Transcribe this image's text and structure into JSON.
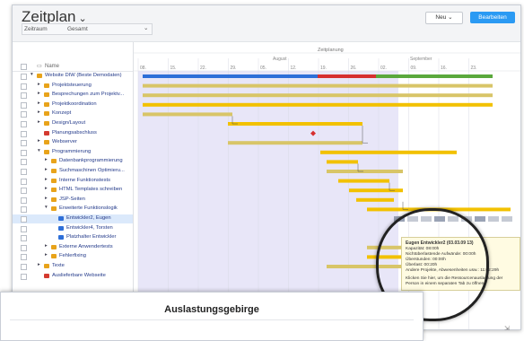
{
  "header": {
    "title": "Zeitplan",
    "title_caret": "⌄",
    "new_label": "Neu ⌄",
    "edit_label": "Bearbeiten"
  },
  "filters": {
    "range_label": "Zeitraum",
    "range_value": "Gesamt",
    "caret": "⌄"
  },
  "tree": {
    "col_name": "Name",
    "items": [
      {
        "label": "Website DIW (Beste Demodaten)",
        "level": 0,
        "icon": "project"
      },
      {
        "label": "Projektsteuerung",
        "level": 1,
        "icon": "folder"
      },
      {
        "label": "Besprechungen zum Projektv...",
        "level": 1,
        "icon": "folder"
      },
      {
        "label": "Projektkoordination",
        "level": 1,
        "icon": "folder"
      },
      {
        "label": "Konzept",
        "level": 1,
        "icon": "folder"
      },
      {
        "label": "Design/Layout",
        "level": 1,
        "icon": "folder"
      },
      {
        "label": "Planungsabschluss",
        "level": 1,
        "icon": "milestone"
      },
      {
        "label": "Webserver",
        "level": 1,
        "icon": "folder"
      },
      {
        "label": "Programmierung",
        "level": 1,
        "icon": "folder"
      },
      {
        "label": "Datenbankprogrammierung",
        "level": 2,
        "icon": "folder"
      },
      {
        "label": "Suchmaschinen Optimieru...",
        "level": 2,
        "icon": "folder"
      },
      {
        "label": "Interne Funktionstests",
        "level": 2,
        "icon": "folder"
      },
      {
        "label": "HTML Templates schreiben",
        "level": 2,
        "icon": "folder"
      },
      {
        "label": "JSP-Seiten",
        "level": 2,
        "icon": "folder"
      },
      {
        "label": "Erweiterte Funktionslogik",
        "level": 2,
        "icon": "folder"
      },
      {
        "label": "Entwickler2, Eugen",
        "level": 3,
        "icon": "person"
      },
      {
        "label": "Entwickler4, Torsten",
        "level": 3,
        "icon": "person"
      },
      {
        "label": "Platzhalter Entwickler",
        "level": 3,
        "icon": "person"
      },
      {
        "label": "Externe Anwendertests",
        "level": 2,
        "icon": "folder"
      },
      {
        "label": "Fehlerfixing",
        "level": 2,
        "icon": "folder"
      },
      {
        "label": "Texte",
        "level": 1,
        "icon": "folder"
      },
      {
        "label": "Auslieferbare Webseite",
        "level": 1,
        "icon": "milestone"
      }
    ]
  },
  "timeline": {
    "group_label": "Zeitplanung",
    "months": [
      "August",
      "September"
    ],
    "weeks": [
      "08.",
      "15.",
      "22.",
      "29.",
      "05.",
      "12.",
      "19.",
      "26.",
      "02.",
      "09.",
      "16.",
      "23."
    ],
    "colors": {
      "bar": "#f2c100",
      "summary_blue": "#2e6fd8",
      "summary_red": "#d62f2f",
      "summary_green": "#5aa83c",
      "milestone": "#d62f2f",
      "shade": "#e8e6f8"
    }
  },
  "tooltip": {
    "title": "Eugen Entwickler2 (03.03.09 13)",
    "lines": [
      "Kapazität: 08:00h",
      "Nichtüberlastende Aufwände: 00:00h",
      "Überstunden: 00:00h",
      "Überlast: 00:20h",
      "Andere Projekte, Abwesenheiten usw.: 11:02:29h",
      "Klicken Sie hier, um die Ressourcenauslastung der Person in einem separaten Tab zu öffnen."
    ]
  },
  "panel": {
    "title": "Auslastungsgebirge"
  }
}
